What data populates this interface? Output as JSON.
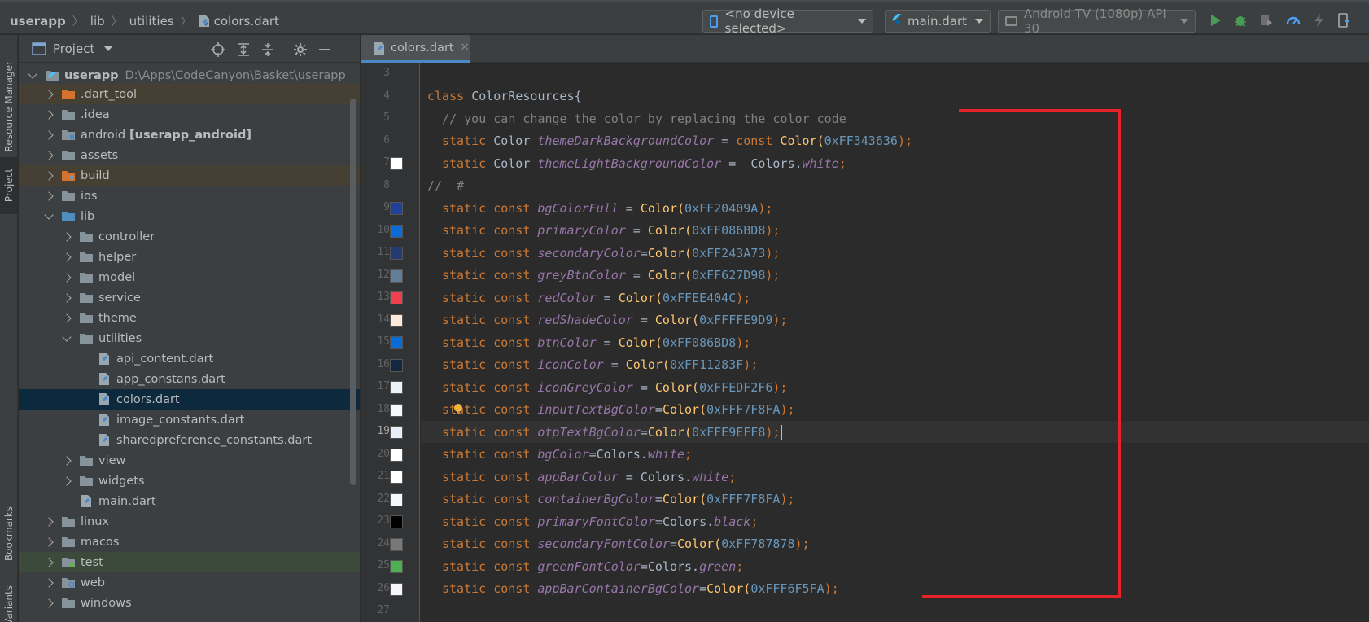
{
  "breadcrumb": [
    "userapp",
    "lib",
    "utilities",
    "colors.dart"
  ],
  "toolbar": {
    "device": "<no device selected>",
    "run_config": "main.dart",
    "emulator": "Android TV (1080p) API 30"
  },
  "left_strip": {
    "resource_manager": "Resource Manager",
    "project": "Project",
    "bookmarks": "Bookmarks",
    "variants": "Variants"
  },
  "project_panel": {
    "title": "Project",
    "root_name": "userapp",
    "root_path": "D:\\Apps\\CodeCanyon\\Basket\\userapp",
    "items": [
      {
        "label": ".dart_tool",
        "extra": ""
      },
      {
        "label": ".idea",
        "extra": ""
      },
      {
        "label": "android",
        "extra": "[userapp_android]"
      },
      {
        "label": "assets",
        "extra": ""
      },
      {
        "label": "build",
        "extra": ""
      },
      {
        "label": "ios",
        "extra": ""
      },
      {
        "label": "lib",
        "extra": ""
      },
      {
        "label": "controller",
        "extra": ""
      },
      {
        "label": "helper",
        "extra": ""
      },
      {
        "label": "model",
        "extra": ""
      },
      {
        "label": "service",
        "extra": ""
      },
      {
        "label": "theme",
        "extra": ""
      },
      {
        "label": "utilities",
        "extra": ""
      },
      {
        "label": "api_content.dart",
        "extra": ""
      },
      {
        "label": "app_constans.dart",
        "extra": ""
      },
      {
        "label": "colors.dart",
        "extra": ""
      },
      {
        "label": "image_constants.dart",
        "extra": ""
      },
      {
        "label": "sharedpreference_constants.dart",
        "extra": ""
      },
      {
        "label": "view",
        "extra": ""
      },
      {
        "label": "widgets",
        "extra": ""
      },
      {
        "label": "main.dart",
        "extra": ""
      },
      {
        "label": "linux",
        "extra": ""
      },
      {
        "label": "macos",
        "extra": ""
      },
      {
        "label": "test",
        "extra": ""
      },
      {
        "label": "web",
        "extra": ""
      },
      {
        "label": "windows",
        "extra": ""
      }
    ]
  },
  "editor": {
    "tab_label": "colors.dart",
    "line_numbers": [
      "3",
      "4",
      "5",
      "6",
      "7",
      "8",
      "9",
      "10",
      "11",
      "12",
      "13",
      "14",
      "15",
      "16",
      "17",
      "18",
      "19",
      "20",
      "21",
      "22",
      "23",
      "24",
      "25",
      "26",
      "27"
    ],
    "current_line": "19",
    "lines": {
      "l4_kw": "class ",
      "l4_name": "ColorResources{",
      "l5": "  // you can change the color by replacing the color code",
      "l8": "//  #"
    },
    "swatches": {
      "l7": "#FFFFFF",
      "l9": "#20409A",
      "l10": "#086BD8",
      "l11": "#243A73",
      "l12": "#627D98",
      "l13": "#EE404C",
      "l14": "#FFE9D9",
      "l15": "#086BD8",
      "l16": "#11283F",
      "l17": "#EDF2F6",
      "l18": "#F7F8FA",
      "l19": "#E9EFF8",
      "l20": "#FFFFFF",
      "l21": "#FFFFFF",
      "l22": "#F7F8FA",
      "l23": "#000000",
      "l24": "#787878",
      "l25": "#4CAF50",
      "l26": "#F6F5FA"
    },
    "static_decls": [
      {
        "kind": "Color",
        "name": "themeDarkBackgroundColor",
        "op": " = ",
        "ctor": "const ",
        "value_kind": "Color(",
        "value": "0xFF343636",
        "tail": ");"
      },
      {
        "kind": "Color",
        "name": "themeLightBackgroundColor",
        "op": " =  ",
        "ctor": "",
        "value_kind": "Colors.",
        "value": "white",
        "tail": ";"
      }
    ],
    "const_decls": [
      {
        "name": "bgColorFull",
        "op": " = ",
        "type": "Color(",
        "value": "0xFF20409A",
        "tail": ");"
      },
      {
        "name": "primaryColor",
        "op": " = ",
        "type": "Color(",
        "value": "0xFF086BD8",
        "tail": ");"
      },
      {
        "name": "secondaryColor",
        "op": "=",
        "type": "Color(",
        "value": "0xFF243A73",
        "tail": ");"
      },
      {
        "name": "greyBtnColor",
        "op": " = ",
        "type": "Color(",
        "value": "0xFF627D98",
        "tail": ");"
      },
      {
        "name": "redColor",
        "op": " = ",
        "type": "Color(",
        "value": "0xFFEE404C",
        "tail": ");"
      },
      {
        "name": "redShadeColor",
        "op": " = ",
        "type": "Color(",
        "value": "0xFFFFE9D9",
        "tail": ");"
      },
      {
        "name": "btnColor",
        "op": " = ",
        "type": "Color(",
        "value": "0xFF086BD8",
        "tail": ");"
      },
      {
        "name": "iconColor",
        "op": " = ",
        "type": "Color(",
        "value": "0xFF11283F",
        "tail": ");"
      },
      {
        "name": "iconGreyColor",
        "op": " = ",
        "type": "Color(",
        "value": "0xFFEDF2F6",
        "tail": ");"
      },
      {
        "name": "inputTextBgColor",
        "op": "=",
        "type": "Color(",
        "value": "0xFFF7F8FA",
        "tail": ");"
      },
      {
        "name": "otpTextBgColor",
        "op": "=",
        "type": "Color(",
        "value": "0xFFE9EFF8",
        "tail": ");"
      },
      {
        "name": "bgColor",
        "op": "=",
        "type": "Colors.",
        "value": "white",
        "tail": ";"
      },
      {
        "name": "appBarColor",
        "op": " = ",
        "type": "Colors.",
        "value": "white",
        "tail": ";"
      },
      {
        "name": "containerBgColor",
        "op": "=",
        "type": "Color(",
        "value": "0xFFF7F8FA",
        "tail": ");"
      },
      {
        "name": "primaryFontColor",
        "op": "=",
        "type": "Colors.",
        "value": "black",
        "tail": ";"
      },
      {
        "name": "secondaryFontColor",
        "op": "=",
        "type": "Color(",
        "value": "0xFF787878",
        "tail": ");"
      },
      {
        "name": "greenFontColor",
        "op": "=",
        "type": "Colors.",
        "value": "green",
        "tail": ";"
      },
      {
        "name": "appBarContainerBgColor",
        "op": "=",
        "type": "Color(",
        "value": "0xFFF6F5FA",
        "tail": ");"
      }
    ]
  },
  "colors": {
    "annotation_red": "#E8222A",
    "selection_blue": "#0D293E",
    "accent_tab": "#4A88C7"
  }
}
